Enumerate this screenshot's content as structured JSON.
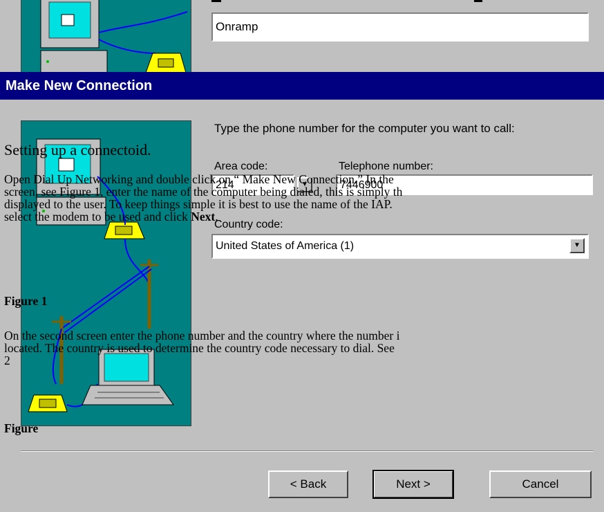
{
  "top_dialog": {
    "name_value": "Onramp"
  },
  "dialog": {
    "title": "Make New Connection",
    "instruction": "Type the phone number for the computer you want to call:",
    "area_code_label": "Area code:",
    "area_code_value": "214",
    "telephone_label": "Telephone number:",
    "telephone_value": "7446900",
    "country_label": "Country code:",
    "country_value": "United States of America (1)",
    "back_label": "< Back",
    "next_label": "Next >",
    "cancel_label": "Cancel"
  },
  "document": {
    "heading": "Setting up a connectoid.",
    "p1_line1": "Open Dial Up Networking and double click on “ Make New Connection.”   In the",
    "p1_line2": "screen, see Figure 1, enter the name of the computer being dialed, this is simply th",
    "p1_line3": "displayed to the user.  To keep things simple it is best to use the name of the IAP.",
    "p1_line4_pre": "select the modem to be used and click ",
    "p1_line4_bold": "Next",
    "p1_line4_post": ".",
    "figure1_label": "Figure 1",
    "p2_line1": "On the second screen enter the phone number and the country where the number i",
    "p2_line2": "located.  The country is used to determine the country code necessary to dial.  See",
    "p2_line3": "2",
    "figure2_label": "Figure"
  },
  "colors": {
    "face": "#c0c0c0",
    "titlebar": "#000080",
    "illustration_bg": "#008080"
  },
  "icons": [
    "computer-icon",
    "telephone-icon",
    "utility-pole-icon",
    "laptop-icon",
    "dropdown-arrow-icon"
  ]
}
